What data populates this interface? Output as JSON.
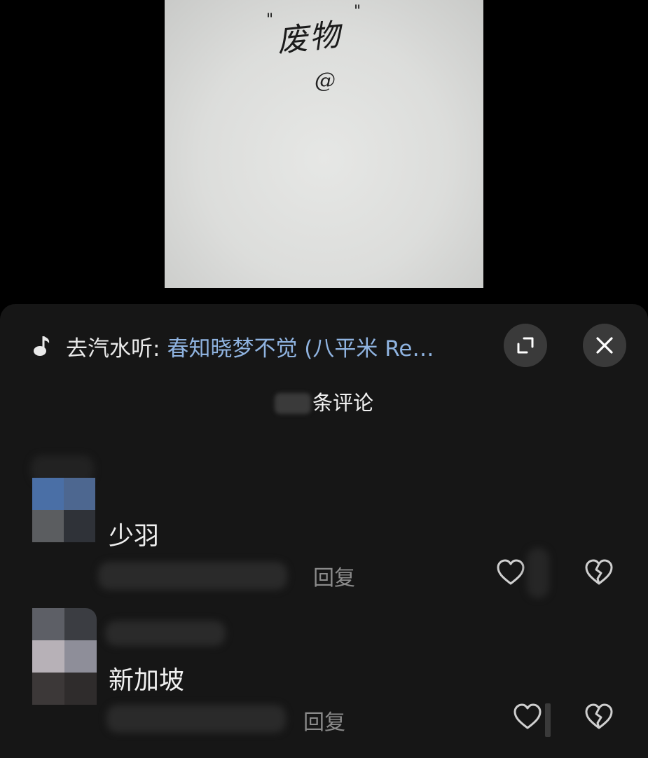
{
  "photo": {
    "handwriting_text": "废物",
    "handwriting_mark": "@"
  },
  "music": {
    "icon": "music-note-icon",
    "prefix": "去汽水听:",
    "title": "春知晓梦不觉 (八平米 Re…"
  },
  "header_buttons": {
    "expand_icon": "expand-icon",
    "close_icon": "close-icon"
  },
  "comments_header": {
    "label": "条评论"
  },
  "comments": [
    {
      "username": "少羽",
      "reply_label": "回复",
      "like_icon": "heart-icon",
      "dislike_icon": "broken-heart-icon"
    },
    {
      "username": "新加坡",
      "reply_label": "回复",
      "like_icon": "heart-icon",
      "dislike_icon": "broken-heart-icon"
    }
  ],
  "colors": {
    "sheet_bg": "#161616",
    "link_blue": "#8fb3e0",
    "button_bg": "#3a3a3a",
    "muted_text": "#8b8b8b"
  }
}
